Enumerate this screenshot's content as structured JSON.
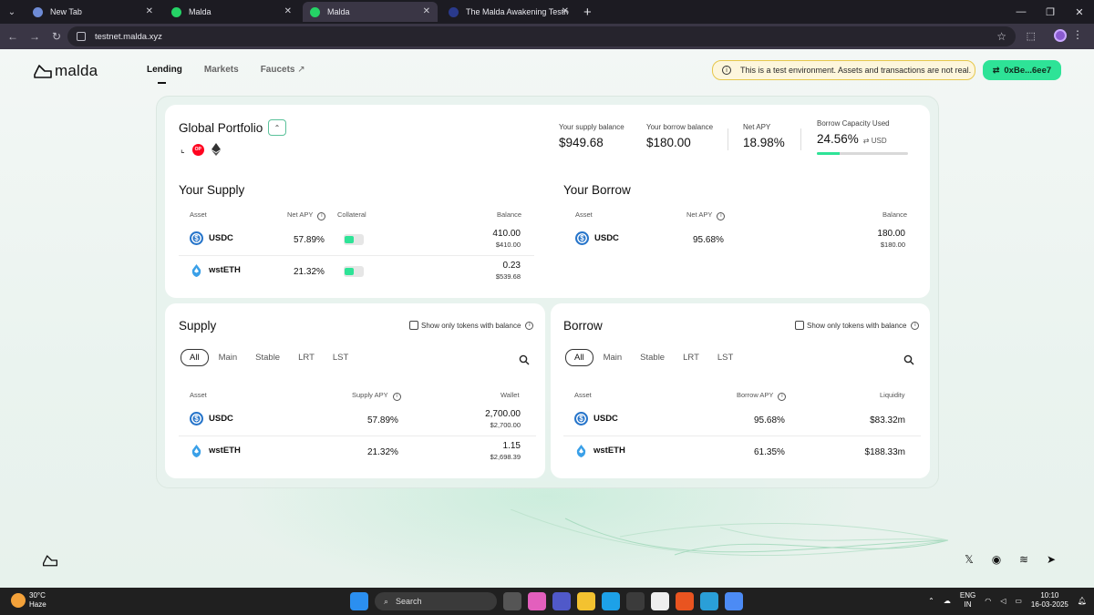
{
  "browser": {
    "tabs": [
      {
        "title": "New Tab",
        "icon": "chrome-icon",
        "active": false
      },
      {
        "title": "Malda",
        "icon": "whatsapp-icon",
        "active": false
      },
      {
        "title": "Malda",
        "icon": "whatsapp-icon",
        "active": true
      },
      {
        "title": "The Malda Awakening Testnet G",
        "icon": "page-icon",
        "active": false
      }
    ],
    "url": "testnet.malda.xyz"
  },
  "app": {
    "logo_text": "malda",
    "nav": [
      {
        "label": "Lending",
        "active": true
      },
      {
        "label": "Markets",
        "active": false
      },
      {
        "label": "Faucets",
        "active": false,
        "external": true
      }
    ],
    "banner_text": "This is a test environment. Assets and transactions are not real.",
    "wallet_label": "0xBe...6ee7",
    "accent_color": "#2ee397"
  },
  "portfolio": {
    "title": "Global Portfolio",
    "stats": [
      {
        "label": "Your supply balance",
        "value": "$949.68"
      },
      {
        "label": "Your borrow balance",
        "value": "$180.00"
      },
      {
        "label": "Net APY",
        "value": "18.98%"
      }
    ],
    "capacity": {
      "label": "Borrow Capacity Used",
      "value": "24.56%",
      "unit": "USD",
      "fraction": 0.2456
    }
  },
  "your_supply": {
    "title": "Your Supply",
    "headers": [
      "Asset",
      "Net APY",
      "Collateral",
      "Balance"
    ],
    "rows": [
      {
        "asset": "USDC",
        "apy": "57.89%",
        "collateral": true,
        "balance": "410.00",
        "balance_usd": "$410.00"
      },
      {
        "asset": "wstETH",
        "apy": "21.32%",
        "collateral": true,
        "balance": "0.23",
        "balance_usd": "$539.68"
      }
    ]
  },
  "your_borrow": {
    "title": "Your Borrow",
    "headers": [
      "Asset",
      "Net APY",
      "Balance"
    ],
    "rows": [
      {
        "asset": "USDC",
        "apy": "95.68%",
        "balance": "180.00",
        "balance_usd": "$180.00"
      }
    ]
  },
  "supply_market": {
    "title": "Supply",
    "checkbox_label": "Show only tokens with balance",
    "filters": [
      "All",
      "Main",
      "Stable",
      "LRT",
      "LST"
    ],
    "headers": [
      "Asset",
      "Supply APY",
      "Wallet"
    ],
    "rows": [
      {
        "asset": "USDC",
        "apy": "57.89%",
        "wallet": "2,700.00",
        "wallet_usd": "$2,700.00"
      },
      {
        "asset": "wstETH",
        "apy": "21.32%",
        "wallet": "1.15",
        "wallet_usd": "$2,698.39"
      }
    ]
  },
  "borrow_market": {
    "title": "Borrow",
    "checkbox_label": "Show only tokens with balance",
    "filters": [
      "All",
      "Main",
      "Stable",
      "LRT",
      "LST"
    ],
    "headers": [
      "Asset",
      "Borrow APY",
      "Liquidity"
    ],
    "rows": [
      {
        "asset": "USDC",
        "apy": "95.68%",
        "liquidity": "$83.32m"
      },
      {
        "asset": "wstETH",
        "apy": "61.35%",
        "liquidity": "$188.33m"
      }
    ]
  },
  "taskbar": {
    "weather_temp": "30°C",
    "weather_desc": "Haze",
    "search_label": "Search",
    "lang_1": "ENG",
    "lang_2": "IN",
    "time": "10:10",
    "date": "16-03-2025"
  }
}
